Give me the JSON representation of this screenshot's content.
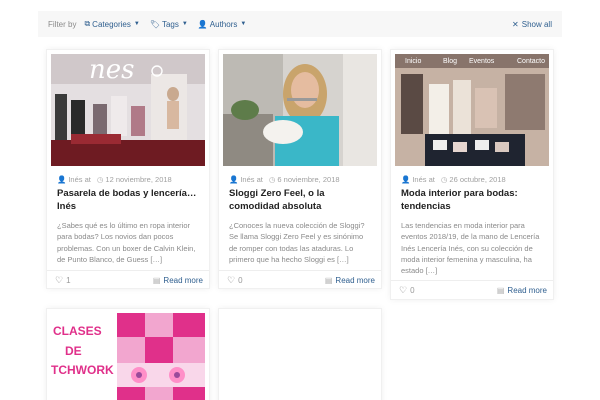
{
  "filter": {
    "label": "Filter by",
    "categories": "Categories",
    "tags": "Tags",
    "authors": "Authors",
    "show_all": "Show all"
  },
  "posts": [
    {
      "image_text": "nes",
      "author": "Inés at",
      "date": "12 noviembre, 2018",
      "title": "Pasarela de bodas y lencería… Inés",
      "excerpt": "¿Sabes qué es lo último en ropa interior para bodas? Los novios dan pocos problemas. Con un boxer de Calvin Klein, de Punto Blanco, de Guess […]",
      "likes": "1",
      "more": "Read more"
    },
    {
      "author": "Inés at",
      "date": "6 noviembre, 2018",
      "title": "Sloggi Zero Feel, o la comodidad absoluta",
      "excerpt": "¿Conoces la nueva colección de Sloggi? Se llama Sloggi Zero Feel y es sinónimo de romper con todas las ataduras. Lo primero que ha hecho Sloggi es […]",
      "likes": "0",
      "more": "Read more"
    },
    {
      "image_menu": [
        "Inicio",
        "Blog",
        "Eventos",
        "Contacto"
      ],
      "author": "Inés at",
      "date": "26 octubre, 2018",
      "title": "Moda interior para bodas: tendencias",
      "excerpt": "Las tendencias en moda interior para eventos 2018/19, de la mano de Lencería Inés Lencería Inés, con su colección de moda interior femenina y masculina, ha estado […]",
      "likes": "0",
      "more": "Read more"
    },
    {
      "image_lines": [
        "CLASES",
        "DE",
        "TCHWORK"
      ]
    }
  ],
  "colors": {
    "link": "#2f5f8f",
    "patchwork_pink": "#e0308a"
  }
}
